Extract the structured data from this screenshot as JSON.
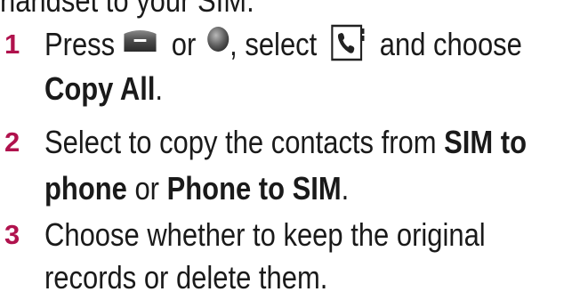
{
  "header_fragment": "handset to your SIM.",
  "steps": [
    {
      "number": "1",
      "line1": {
        "press": "Press",
        "or": " or ",
        "select": ", select ",
        "choose": " and choose"
      },
      "line2": {
        "bold": "Copy All",
        "tail": "."
      },
      "icons": [
        "menu-softkey-icon",
        "ok-button-icon",
        "contacts-icon"
      ]
    },
    {
      "number": "2",
      "line1": {
        "text": "Select to copy the contacts from ",
        "bold": "SIM to"
      },
      "line2": {
        "bold1": "phone",
        "mid": " or ",
        "bold2": "Phone to SIM",
        "tail": "."
      }
    },
    {
      "number": "3",
      "line1": {
        "text": "Choose whether to keep the original"
      },
      "line2": {
        "text": "records or delete them."
      }
    }
  ],
  "colors": {
    "step_number": "#b0124d",
    "text": "#1a1a1a"
  }
}
